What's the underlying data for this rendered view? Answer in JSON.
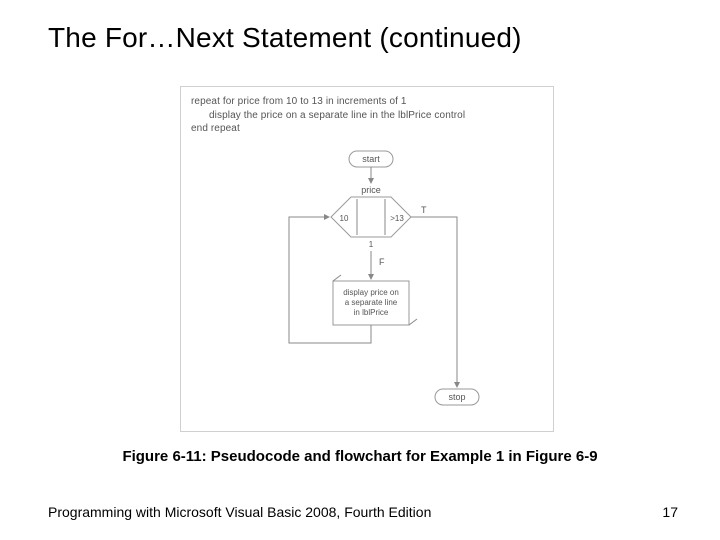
{
  "title": "The For…Next Statement (continued)",
  "pseudocode": {
    "line1": "repeat for price from 10 to 13 in increments of 1",
    "line2": "display the price on a separate line in the lblPrice control",
    "line3": "end repeat"
  },
  "flowchart": {
    "start": "start",
    "loop_var": "price",
    "init": "10",
    "cond": ">13",
    "step": "1",
    "true_label": "T",
    "false_label": "F",
    "process_line1": "display price on",
    "process_line2": "a separate line",
    "process_line3": "in lblPrice",
    "stop": "stop"
  },
  "caption": "Figure 6-11: Pseudocode and flowchart for Example 1 in Figure 6-9",
  "footer": {
    "left": "Programming with Microsoft Visual Basic 2008, Fourth Edition",
    "page": "17"
  }
}
